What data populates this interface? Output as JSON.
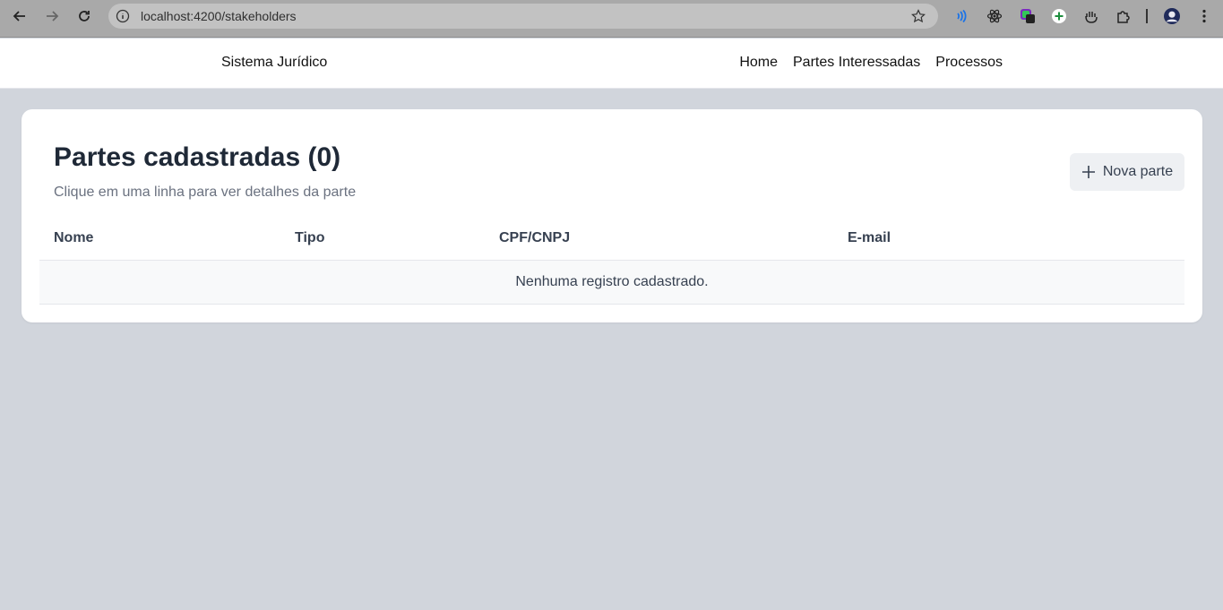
{
  "browser": {
    "url": "localhost:4200/stakeholders"
  },
  "header": {
    "brand": "Sistema Jurídico",
    "nav": [
      "Home",
      "Partes Interessadas",
      "Processos"
    ]
  },
  "main": {
    "title": "Partes cadastradas (0)",
    "subtitle": "Clique em uma linha para ver detalhes da parte",
    "new_button_label": "Nova parte",
    "table": {
      "columns": [
        "Nome",
        "Tipo",
        "CPF/CNPJ",
        "E-mail"
      ],
      "empty_message": "Nenhuma registro cadastrado."
    }
  },
  "colors": {
    "page_background": "#d1d5dc",
    "card_background": "#ffffff",
    "button_background": "#eef0f3"
  }
}
